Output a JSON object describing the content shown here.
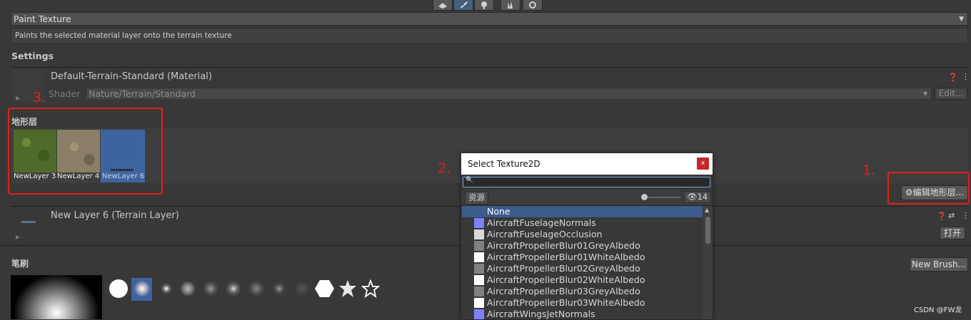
{
  "toolbar": {
    "icons": [
      "raise-terrain-icon",
      "paint-brush-icon",
      "tree-icon",
      "details-icon",
      "settings-icon"
    ],
    "active_index": 1
  },
  "tool_dropdown": {
    "value": "Paint Texture"
  },
  "help_text": "Paints the selected material layer onto the terrain texture",
  "settings": {
    "title": "Settings",
    "material_name": "Default-Terrain-Standard (Material)",
    "shader_label": "Shader",
    "shader_value": "Nature/Terrain/Standard",
    "edit_button": "Edit..."
  },
  "terrain_layers": {
    "title": "地形层",
    "layers": [
      {
        "name": "NewLayer 3",
        "color": "#4e6a2a"
      },
      {
        "name": "NewLayer 4",
        "color": "#8a7e66"
      },
      {
        "name": "NewLayer 6",
        "color": "#3e64a0"
      }
    ],
    "selected_index": 2,
    "edit_layers_button": "编辑地形层..."
  },
  "terrain_layer_detail": {
    "title": "New Layer 6 (Terrain Layer)",
    "open_button": "打开"
  },
  "brushes": {
    "title": "笔刷",
    "new_brush_button": "New Brush..."
  },
  "annotations": {
    "one": "1.",
    "two": "2.",
    "three": "3."
  },
  "dialog": {
    "title": "Select Texture2D",
    "close_glyph": "x",
    "search_value": "",
    "assets_tab": "资源",
    "hidden_count": "14",
    "items": [
      {
        "name": "None",
        "swatch": ""
      },
      {
        "name": "AircraftFuselageNormals",
        "swatch": "#8080ff"
      },
      {
        "name": "AircraftFuselageOcclusion",
        "swatch": "#d8d8d8"
      },
      {
        "name": "AircraftPropellerBlur01GreyAlbedo",
        "swatch": "#808080"
      },
      {
        "name": "AircraftPropellerBlur01WhiteAlbedo",
        "swatch": "#ffffff"
      },
      {
        "name": "AircraftPropellerBlur02GreyAlbedo",
        "swatch": "#808080"
      },
      {
        "name": "AircraftPropellerBlur02WhiteAlbedo",
        "swatch": "#ffffff"
      },
      {
        "name": "AircraftPropellerBlur03GreyAlbedo",
        "swatch": "#808080"
      },
      {
        "name": "AircraftPropellerBlur03WhiteAlbedo",
        "swatch": "#ffffff"
      },
      {
        "name": "AircraftWingsJetNormals",
        "swatch": "#8080ff"
      }
    ],
    "selected_index": 0
  },
  "watermark": "CSDN @FW龙",
  "colors": {
    "accent": "#3b5c8c",
    "annotation_red": "#e0201c"
  }
}
